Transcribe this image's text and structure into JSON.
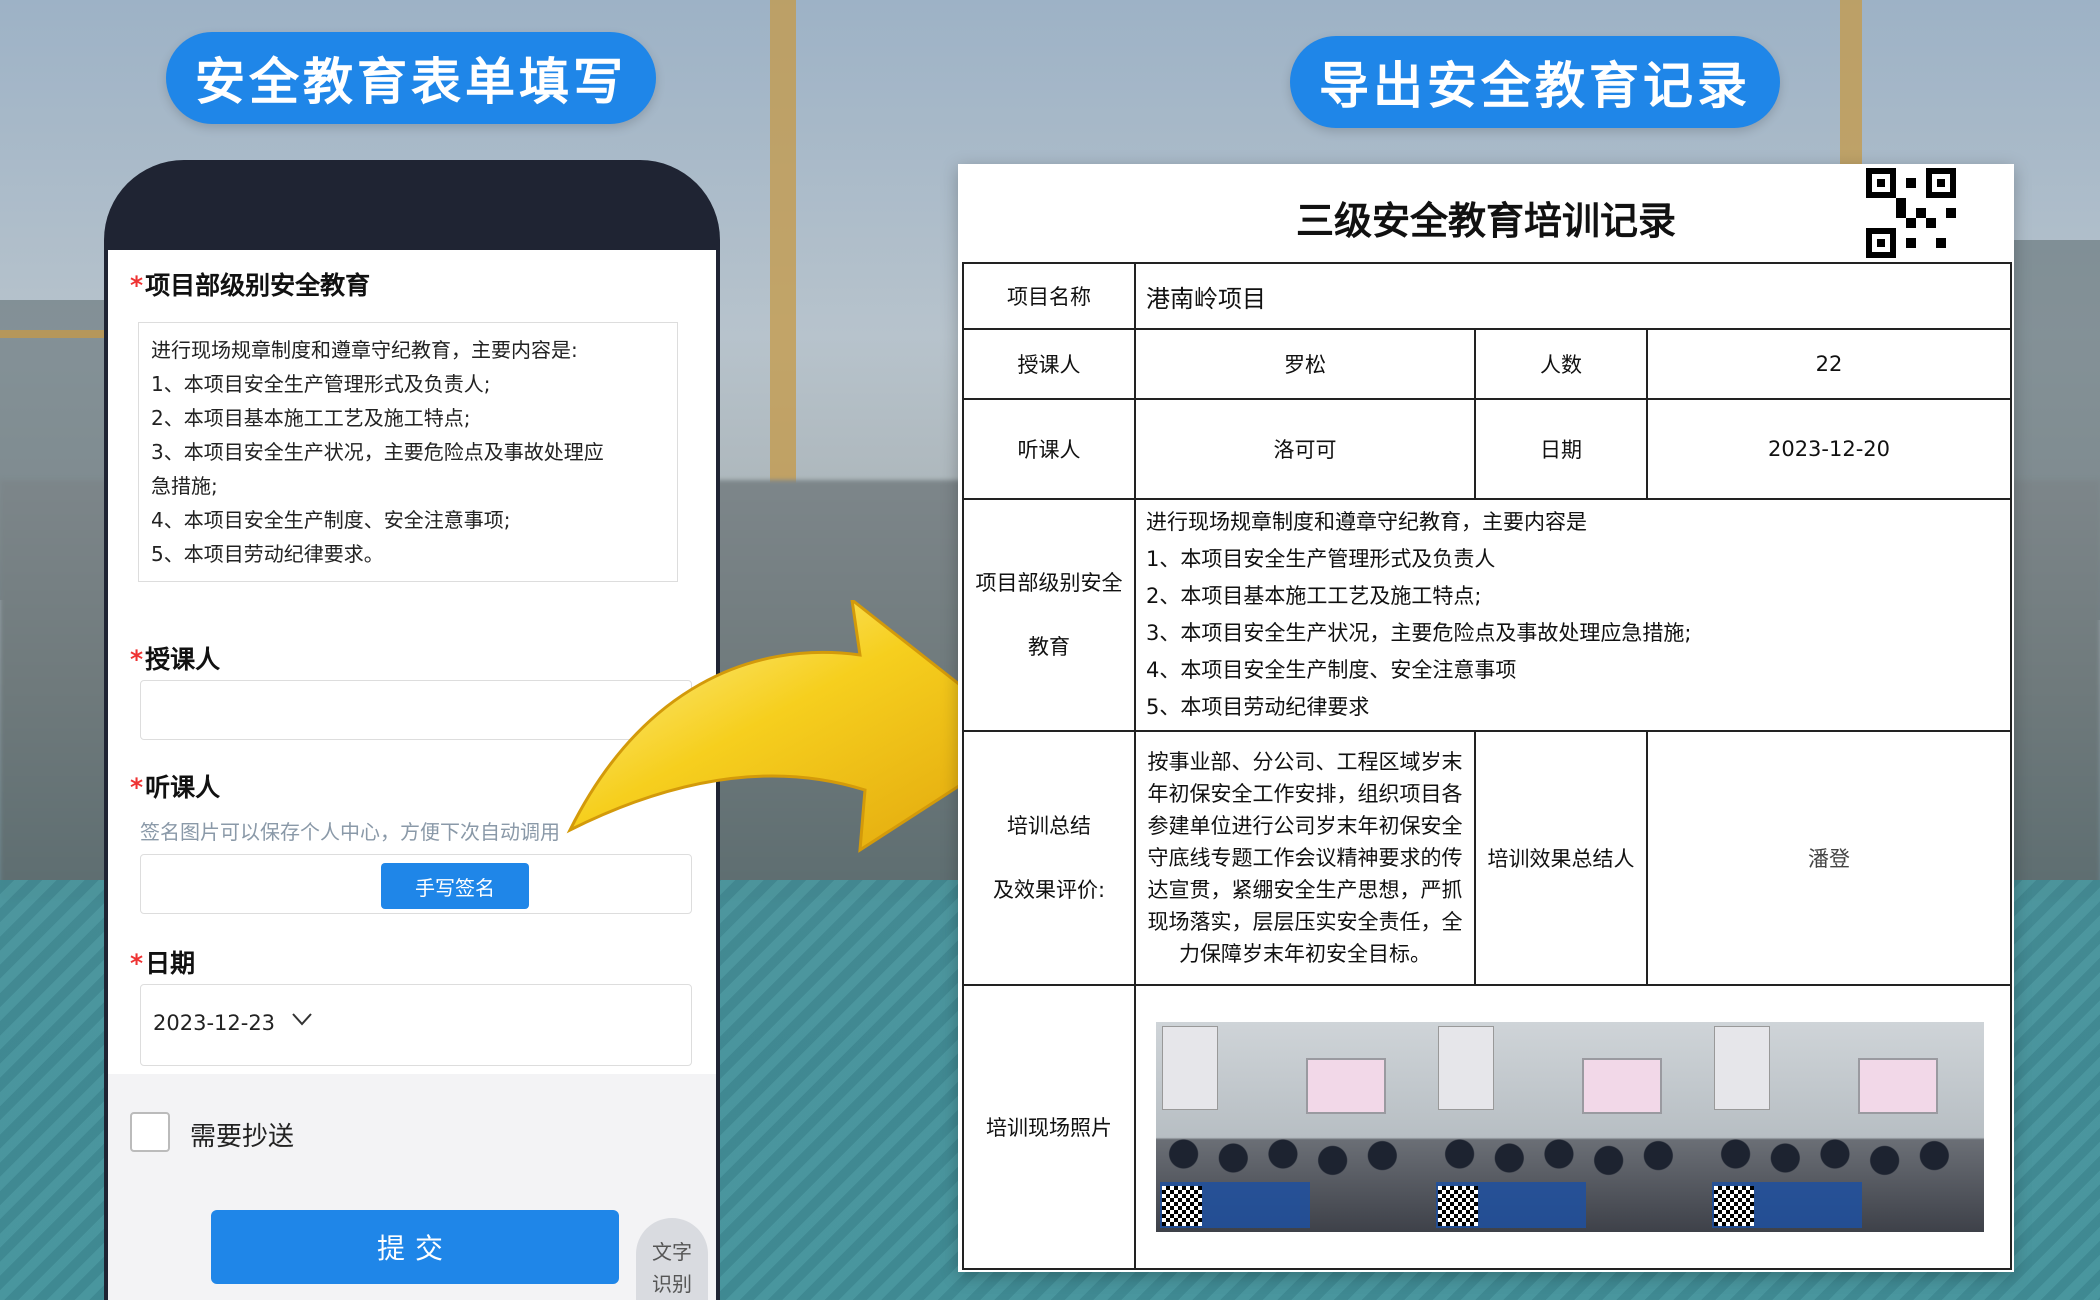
{
  "headings": {
    "left": "安全教育表单填写",
    "right": "导出安全教育记录"
  },
  "form": {
    "section1_label": "项目部级别安全教育",
    "section1_lines": [
      "进行现场规章制度和遵章守纪教育，主要内容是:",
      "1、本项目安全生产管理形式及负责人;",
      "2、本项目基本施工工艺及施工特点;",
      "3、本项目安全生产状况，主要危险点及事故处理应",
      "急措施;",
      "4、本项目安全生产制度、安全注意事项;",
      "5、本项目劳动纪律要求。"
    ],
    "teacher_label": "授课人",
    "listener_label": "听课人",
    "signature_hint": "签名图片可以保存个人中心，方便下次自动调用",
    "signature_button": "手写签名",
    "date_label": "日期",
    "date_value": "2023-12-23",
    "date_chevron": "chevron-down-icon",
    "cc_label": "需要抄送",
    "submit_label": "提交",
    "ocr_label_line1": "文字",
    "ocr_label_line2": "识别"
  },
  "record": {
    "title": "三级安全教育培训记录",
    "project_name_label": "项目名称",
    "project_name": "港南岭项目",
    "teacher_label": "授课人",
    "teacher": "罗松",
    "count_label": "人数",
    "count": "22",
    "listener_label": "听课人",
    "listener": "洛可可",
    "date_label": "日期",
    "date": "2023-12-20",
    "education_label_line1": "项目部级别安全",
    "education_label_line2": "教育",
    "education_lines": [
      "进行现场规章制度和遵章守纪教育，主要内容是",
      "1、本项目安全生产管理形式及负责人",
      "2、本项目基本施工工艺及施工特点;",
      "3、本项目安全生产状况，主要危险点及事故处理应急措施;",
      "4、本项目安全生产制度、安全注意事项",
      "5、本项目劳动纪律要求"
    ],
    "summary_label_line1": "培训总结",
    "summary_label_line2": "及效果评价:",
    "summary_text": "按事业部、分公司、工程区域岁末年初保安全工作安排，组织项目各参建单位进行公司岁末年初保安全守底线专题工作会议精神要求的传达宣贯，紧绷安全生产思想，严抓现场落实，层层压实安全责任，全力保障岁末年初安全目标。",
    "summarizer_label": "培训效果总结人",
    "summarizer": "潘登",
    "photos_label": "培训现场照片"
  },
  "colors": {
    "accent": "#1f86e8",
    "required": "#e33333",
    "arrow": "#f2c51a"
  }
}
